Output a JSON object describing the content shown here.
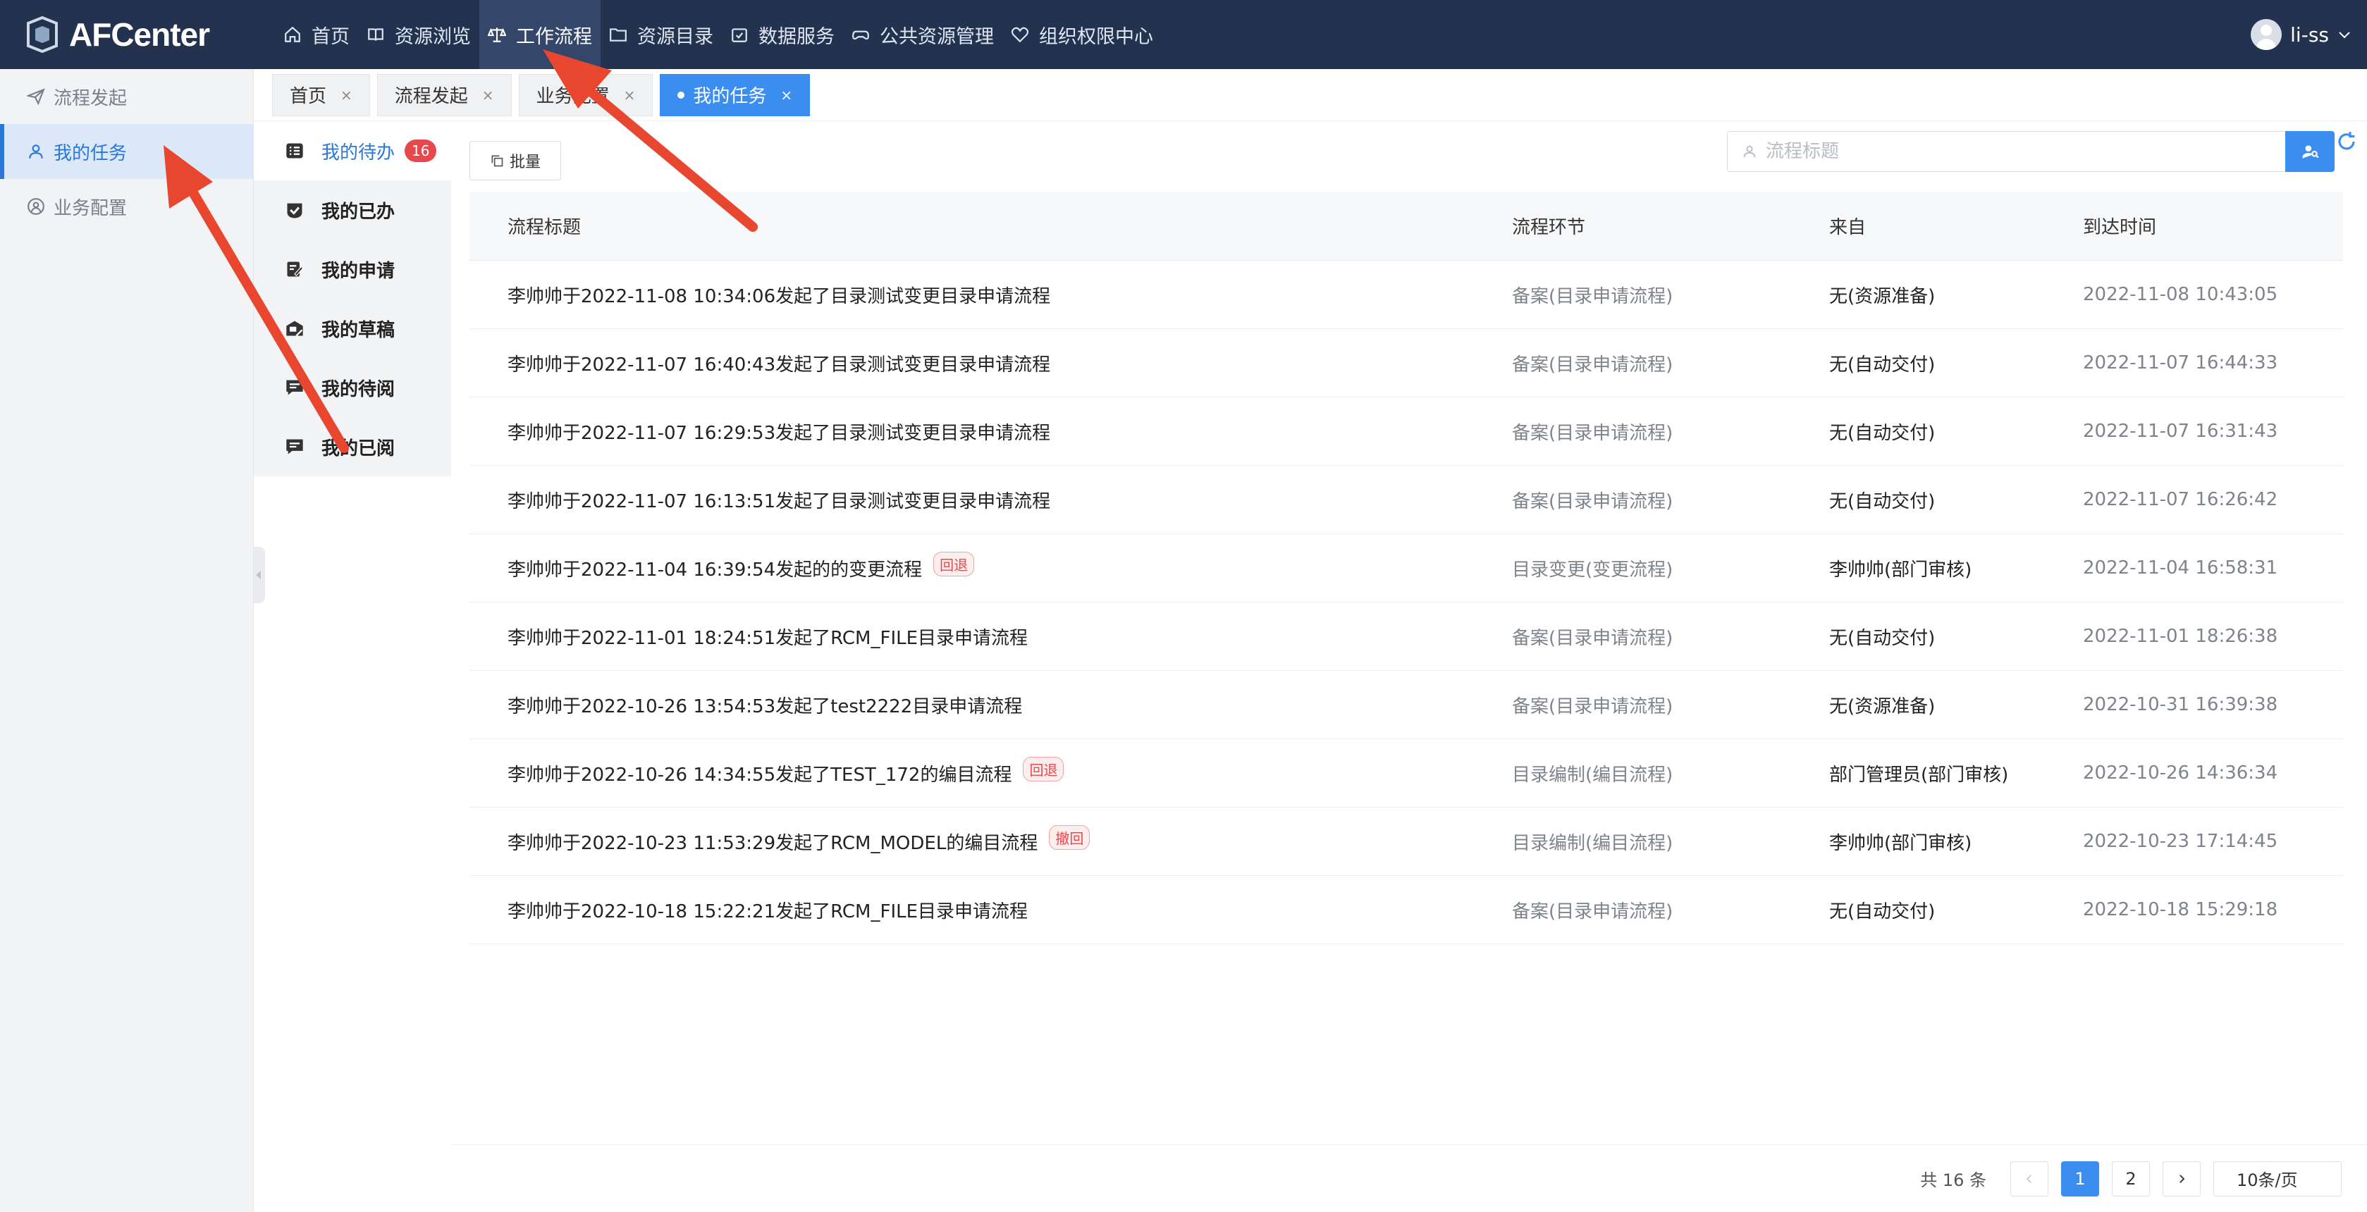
{
  "app": {
    "name": "AFCenter"
  },
  "topnav": [
    {
      "label": "首页",
      "icon": "home-icon"
    },
    {
      "label": "资源浏览",
      "icon": "book-icon"
    },
    {
      "label": "工作流程",
      "icon": "workflow-icon",
      "active": true
    },
    {
      "label": "资源目录",
      "icon": "folder-icon"
    },
    {
      "label": "数据服务",
      "icon": "calendar-check-icon"
    },
    {
      "label": "公共资源管理",
      "icon": "gamepad-icon"
    },
    {
      "label": "组织权限中心",
      "icon": "heart-icon"
    }
  ],
  "user": {
    "name": "li-ss"
  },
  "sidebar": [
    {
      "label": "流程发起",
      "icon": "send-icon"
    },
    {
      "label": "我的任务",
      "icon": "user-icon",
      "active": true
    },
    {
      "label": "业务配置",
      "icon": "user-circle-icon"
    }
  ],
  "tabs": [
    {
      "label": "首页",
      "close": "×"
    },
    {
      "label": "流程发起",
      "close": "×"
    },
    {
      "label": "业务配置",
      "close": "×"
    },
    {
      "label": "我的任务",
      "close": "×",
      "active": true
    }
  ],
  "subnav": [
    {
      "label": "我的待办",
      "badge": "16",
      "active": true
    },
    {
      "label": "我的已办"
    },
    {
      "label": "我的申请"
    },
    {
      "label": "我的草稿"
    },
    {
      "label": "我的待阅"
    },
    {
      "label": "我的已阅"
    }
  ],
  "toolbar": {
    "batch_label": "批量"
  },
  "search": {
    "placeholder": "流程标题",
    "value": ""
  },
  "table": {
    "headers": [
      "流程标题",
      "流程环节",
      "来自",
      "到达时间"
    ],
    "rows": [
      {
        "title": "李帅帅于2022-11-08 10:34:06发起了目录测试变更目录申请流程",
        "tag": "",
        "stage": "备案(目录申请流程)",
        "from": "无(资源准备)",
        "time": "2022-11-08 10:43:05"
      },
      {
        "title": "李帅帅于2022-11-07 16:40:43发起了目录测试变更目录申请流程",
        "tag": "",
        "stage": "备案(目录申请流程)",
        "from": "无(自动交付)",
        "time": "2022-11-07 16:44:33"
      },
      {
        "title": "李帅帅于2022-11-07 16:29:53发起了目录测试变更目录申请流程",
        "tag": "",
        "stage": "备案(目录申请流程)",
        "from": "无(自动交付)",
        "time": "2022-11-07 16:31:43"
      },
      {
        "title": "李帅帅于2022-11-07 16:13:51发起了目录测试变更目录申请流程",
        "tag": "",
        "stage": "备案(目录申请流程)",
        "from": "无(自动交付)",
        "time": "2022-11-07 16:26:42"
      },
      {
        "title": "李帅帅于2022-11-04 16:39:54发起的的变更流程",
        "tag": "回退",
        "stage": "目录变更(变更流程)",
        "from": "李帅帅(部门审核)",
        "time": "2022-11-04 16:58:31"
      },
      {
        "title": "李帅帅于2022-11-01 18:24:51发起了RCM_FILE目录申请流程",
        "tag": "",
        "stage": "备案(目录申请流程)",
        "from": "无(自动交付)",
        "time": "2022-11-01 18:26:38"
      },
      {
        "title": "李帅帅于2022-10-26 13:54:53发起了test2222目录申请流程",
        "tag": "",
        "stage": "备案(目录申请流程)",
        "from": "无(资源准备)",
        "time": "2022-10-31 16:39:38"
      },
      {
        "title": "李帅帅于2022-10-26 14:34:55发起了TEST_172的编目流程",
        "tag": "回退",
        "stage": "目录编制(编目流程)",
        "from": "部门管理员(部门审核)",
        "time": "2022-10-26 14:36:34"
      },
      {
        "title": "李帅帅于2022-10-23 11:53:29发起了RCM_MODEL的编目流程",
        "tag": "撤回",
        "stage": "目录编制(编目流程)",
        "from": "李帅帅(部门审核)",
        "time": "2022-10-23 17:14:45"
      },
      {
        "title": "李帅帅于2022-10-18 15:22:21发起了RCM_FILE目录申请流程",
        "tag": "",
        "stage": "备案(目录申请流程)",
        "from": "无(自动交付)",
        "time": "2022-10-18 15:29:18"
      }
    ]
  },
  "pagination": {
    "total_label": "共 16 条",
    "pages": [
      "1",
      "2"
    ],
    "current": "1",
    "page_size": "10条/页"
  },
  "colors": {
    "header_bg": "#23324f",
    "accent": "#3b8ef0",
    "annotation_arrow": "#e8462f",
    "badge": "#e5484d"
  }
}
